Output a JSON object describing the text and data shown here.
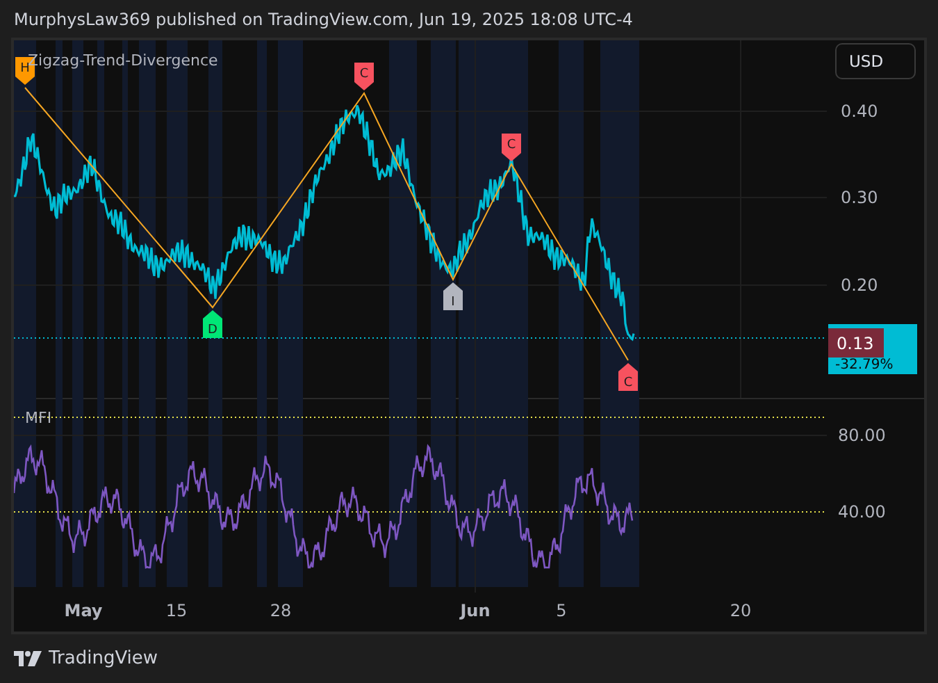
{
  "header": {
    "title": "MurphysLaw369 published on TradingView.com, Jun 19, 2025 18:08 UTC-4"
  },
  "chart": {
    "indicator_title": "Zigzag-Trend-Divergence",
    "currency_button": "USD",
    "price_ticks": [
      "0.40",
      "0.30",
      "0.20"
    ],
    "last_price": "0.13",
    "change": "-32.79%",
    "pivots": [
      {
        "label": "H",
        "kind": "top",
        "color": "#ff9800"
      },
      {
        "label": "D",
        "kind": "bottom",
        "color": "#00e676"
      },
      {
        "label": "C",
        "kind": "top",
        "color": "#f7525f"
      },
      {
        "label": "I",
        "kind": "bottom",
        "color": "#b2b5be"
      },
      {
        "label": "C",
        "kind": "top",
        "color": "#f7525f"
      },
      {
        "label": "C",
        "kind": "bottom",
        "color": "#f7525f"
      }
    ],
    "mfi": {
      "title": "MFI",
      "ticks": [
        "80.00",
        "40.00"
      ]
    },
    "time_ticks": [
      "May",
      "15",
      "28",
      "Jun",
      "5",
      "20"
    ]
  },
  "footer": {
    "brand": "TradingView"
  }
}
